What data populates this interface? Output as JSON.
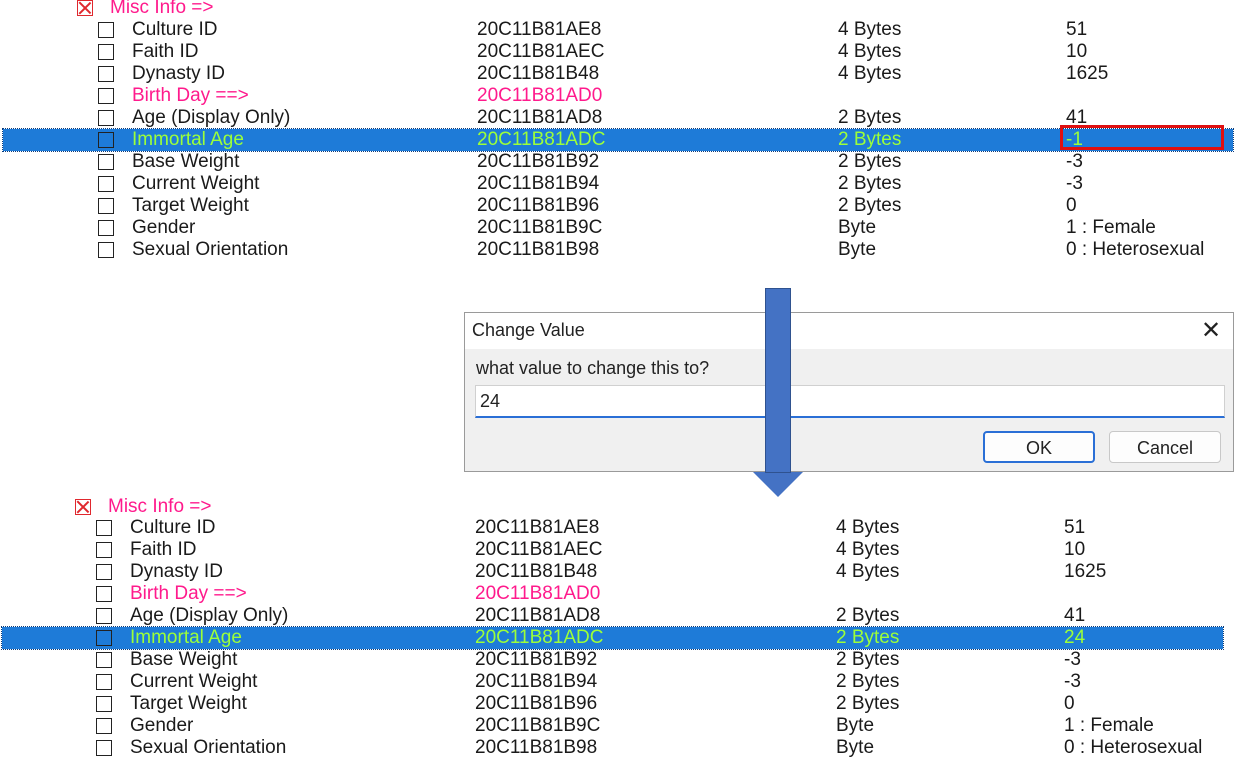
{
  "top_table": {
    "header": "Misc Info =>",
    "rows": [
      {
        "name": "Culture ID",
        "address": "20C11B81AE8",
        "type": "4 Bytes",
        "value": "51"
      },
      {
        "name": "Faith ID",
        "address": "20C11B81AEC",
        "type": "4 Bytes",
        "value": "10"
      },
      {
        "name": "Dynasty ID",
        "address": "20C11B81B48",
        "type": "4 Bytes",
        "value": "1625"
      },
      {
        "name": "Birth Day ==>",
        "address": "20C11B81AD0",
        "type": "",
        "value": ""
      },
      {
        "name": "Age (Display Only)",
        "address": "20C11B81AD8",
        "type": "2 Bytes",
        "value": "41"
      },
      {
        "name": "Immortal Age",
        "address": "20C11B81ADC",
        "type": "2 Bytes",
        "value": "-1"
      },
      {
        "name": "Base Weight",
        "address": "20C11B81B92",
        "type": "2 Bytes",
        "value": "-3"
      },
      {
        "name": "Current Weight",
        "address": "20C11B81B94",
        "type": "2 Bytes",
        "value": "-3"
      },
      {
        "name": "Target Weight",
        "address": "20C11B81B96",
        "type": "2 Bytes",
        "value": "0"
      },
      {
        "name": "Gender",
        "address": "20C11B81B9C",
        "type": "Byte",
        "value": "1 :  Female"
      },
      {
        "name": "Sexual Orientation",
        "address": "20C11B81B98",
        "type": "Byte",
        "value": "0 :  Heterosexual"
      }
    ]
  },
  "dialog": {
    "title": "Change Value",
    "close_glyph": "✕",
    "prompt": "what value to change this to?",
    "input_value": "24",
    "ok_label": "OK",
    "cancel_label": "Cancel"
  },
  "bottom_table": {
    "header": "Misc Info =>",
    "rows": [
      {
        "name": "Culture ID",
        "address": "20C11B81AE8",
        "type": "4 Bytes",
        "value": "51"
      },
      {
        "name": "Faith ID",
        "address": "20C11B81AEC",
        "type": "4 Bytes",
        "value": "10"
      },
      {
        "name": "Dynasty ID",
        "address": "20C11B81B48",
        "type": "4 Bytes",
        "value": "1625"
      },
      {
        "name": "Birth Day ==>",
        "address": "20C11B81AD0",
        "type": "",
        "value": ""
      },
      {
        "name": "Age (Display Only)",
        "address": "20C11B81AD8",
        "type": "2 Bytes",
        "value": "41"
      },
      {
        "name": "Immortal Age",
        "address": "20C11B81ADC",
        "type": "2 Bytes",
        "value": "24"
      },
      {
        "name": "Base Weight",
        "address": "20C11B81B92",
        "type": "2 Bytes",
        "value": "-3"
      },
      {
        "name": "Current Weight",
        "address": "20C11B81B94",
        "type": "2 Bytes",
        "value": "-3"
      },
      {
        "name": "Target Weight",
        "address": "20C11B81B96",
        "type": "2 Bytes",
        "value": "0"
      },
      {
        "name": "Gender",
        "address": "20C11B81B9C",
        "type": "Byte",
        "value": "1 :  Female"
      },
      {
        "name": "Sexual Orientation",
        "address": "20C11B81B98",
        "type": "Byte",
        "value": "0 :  Heterosexual"
      }
    ]
  },
  "colors": {
    "selection_bg": "#1e7bd8",
    "selection_text": "#9cff3a",
    "group_text": "#ff1a8c",
    "highlight_border": "#e01010",
    "arrow": "#4472c4"
  },
  "icons": {
    "header_checkbox": "checked-x-icon",
    "row_checkbox": "empty-checkbox-icon",
    "close": "close-icon",
    "arrow": "down-arrow-icon"
  }
}
